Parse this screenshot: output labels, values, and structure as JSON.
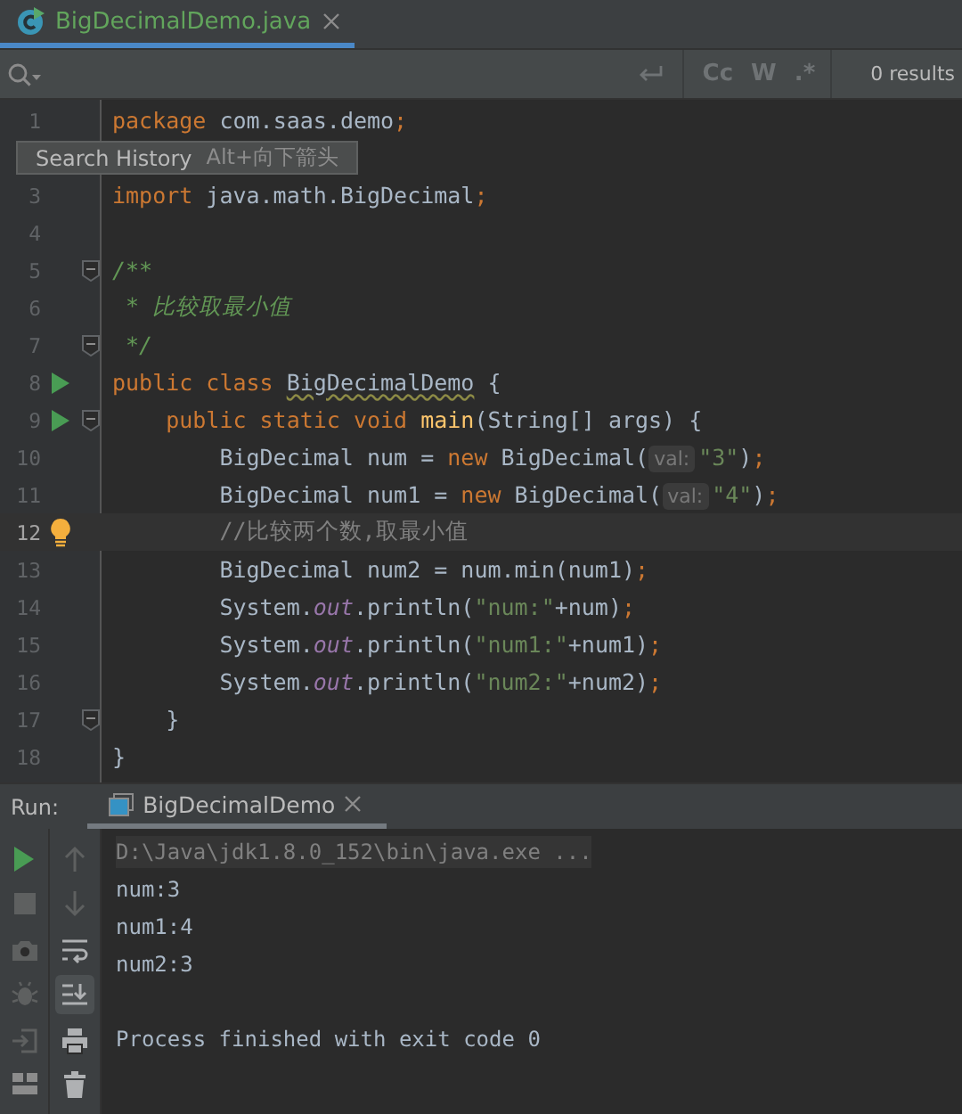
{
  "editor_tab": {
    "title": "BigDecimalDemo.java",
    "selected": true
  },
  "search": {
    "options": [
      {
        "label": "Cc",
        "selected": false
      },
      {
        "label": "W",
        "selected": false
      },
      {
        "label": ".*",
        "selected": false
      }
    ],
    "results": "0 results"
  },
  "lines": [
    {
      "number": "1",
      "tokens": [
        {
          "kind": "kw",
          "text": "package"
        },
        {
          "kind": "txt",
          "text": " com.saas.demo"
        },
        {
          "kind": "semi",
          "text": ";"
        }
      ]
    },
    {
      "kind": "tooltip",
      "label": "Search History",
      "shortcut": "Alt+向下箭头"
    },
    {
      "number": "3",
      "tokens": [
        {
          "kind": "kw",
          "text": "import"
        },
        {
          "kind": "txt",
          "text": " java.math.BigDecimal"
        },
        {
          "kind": "semi",
          "text": ";"
        }
      ]
    },
    {
      "number": "4"
    },
    {
      "number": "5",
      "fold": true,
      "tokens": [
        {
          "kind": "doc",
          "text": "/**"
        }
      ]
    },
    {
      "number": "6",
      "tokens": [
        {
          "kind": "doc",
          "text": " * 比较取最小值"
        }
      ]
    },
    {
      "number": "7",
      "fold": true,
      "tokens": [
        {
          "kind": "doc",
          "text": " */"
        }
      ]
    },
    {
      "number": "8",
      "run": true,
      "tokens": [
        {
          "kind": "kw",
          "text": "public class "
        },
        {
          "kind": "warn",
          "text": "BigDecimalDemo"
        },
        {
          "kind": "txt",
          "text": " {"
        }
      ]
    },
    {
      "number": "9",
      "run": true,
      "fold": true,
      "tokens": [
        {
          "kind": "kw",
          "text": "    public static void "
        },
        {
          "kind": "fn",
          "text": "main"
        },
        {
          "kind": "txt",
          "text": "(String[] args) {"
        }
      ]
    },
    {
      "number": "10",
      "tokens": [
        {
          "kind": "txt",
          "text": "        BigDecimal num = "
        },
        {
          "kind": "kw",
          "text": "new "
        },
        {
          "kind": "txt",
          "text": "BigDecimal("
        },
        {
          "kind": "hint",
          "text": "val:"
        },
        {
          "kind": "str",
          "text": "\"3\""
        },
        {
          "kind": "txt",
          "text": ")"
        },
        {
          "kind": "semi",
          "text": ";"
        }
      ]
    },
    {
      "number": "11",
      "tokens": [
        {
          "kind": "txt",
          "text": "        BigDecimal num1 = "
        },
        {
          "kind": "kw",
          "text": "new "
        },
        {
          "kind": "txt",
          "text": "BigDecimal("
        },
        {
          "kind": "hint",
          "text": "val:"
        },
        {
          "kind": "str",
          "text": "\"4\""
        },
        {
          "kind": "txt",
          "text": ")"
        },
        {
          "kind": "semi",
          "text": ";"
        }
      ]
    },
    {
      "number": "12",
      "current": true,
      "bulb": true,
      "tokens": [
        {
          "kind": "cmt",
          "text": "        //比较两个数,取最小值"
        }
      ]
    },
    {
      "number": "13",
      "tokens": [
        {
          "kind": "txt",
          "text": "        BigDecimal num2 = num.min(num1)"
        },
        {
          "kind": "semi",
          "text": ";"
        }
      ]
    },
    {
      "number": "14",
      "tokens": [
        {
          "kind": "txt",
          "text": "        System."
        },
        {
          "kind": "field",
          "text": "out"
        },
        {
          "kind": "txt",
          "text": ".println("
        },
        {
          "kind": "str",
          "text": "\"num:\""
        },
        {
          "kind": "txt",
          "text": "+num)"
        },
        {
          "kind": "semi",
          "text": ";"
        }
      ]
    },
    {
      "number": "15",
      "tokens": [
        {
          "kind": "txt",
          "text": "        System."
        },
        {
          "kind": "field",
          "text": "out"
        },
        {
          "kind": "txt",
          "text": ".println("
        },
        {
          "kind": "str",
          "text": "\"num1:\""
        },
        {
          "kind": "txt",
          "text": "+num1)"
        },
        {
          "kind": "semi",
          "text": ";"
        }
      ]
    },
    {
      "number": "16",
      "tokens": [
        {
          "kind": "txt",
          "text": "        System."
        },
        {
          "kind": "field",
          "text": "out"
        },
        {
          "kind": "txt",
          "text": ".println("
        },
        {
          "kind": "str",
          "text": "\"num2:\""
        },
        {
          "kind": "txt",
          "text": "+num2)"
        },
        {
          "kind": "semi",
          "text": ";"
        }
      ]
    },
    {
      "number": "17",
      "fold": true,
      "tokens": [
        {
          "kind": "txt",
          "text": "    }"
        }
      ]
    },
    {
      "number": "18",
      "tokens": [
        {
          "kind": "txt",
          "text": "}"
        }
      ]
    }
  ],
  "run_panel": {
    "label": "Run:",
    "tab": {
      "title": "BigDecimalDemo",
      "selected": true
    },
    "left_tools": [
      {
        "kind": "run"
      },
      {
        "kind": "stop"
      },
      {
        "kind": "camera"
      },
      {
        "kind": "bug"
      },
      {
        "kind": "exit"
      },
      {
        "kind": "layout"
      }
    ],
    "tools": [
      {
        "kind": "up",
        "selected": false
      },
      {
        "kind": "down",
        "selected": false
      },
      {
        "kind": "wrap",
        "selected": false
      },
      {
        "kind": "scroll",
        "selected": true
      },
      {
        "kind": "print",
        "selected": false
      },
      {
        "kind": "trash",
        "selected": false
      }
    ],
    "console": [
      {
        "kind": "command",
        "text": "D:\\Java\\jdk1.8.0_152\\bin\\java.exe ..."
      },
      {
        "kind": "output",
        "text": "num:3"
      },
      {
        "kind": "output",
        "text": "num1:4"
      },
      {
        "kind": "output",
        "text": "num2:3"
      },
      {
        "kind": "exit",
        "text": "Process finished with exit code 0"
      }
    ]
  }
}
